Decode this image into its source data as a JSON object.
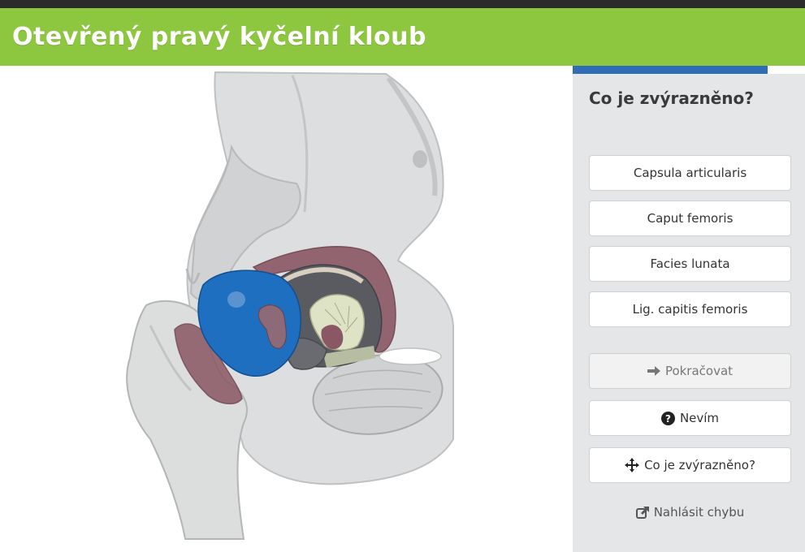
{
  "header": {
    "title": "Otevřený pravý kyčelní kloub"
  },
  "progress": {
    "fraction": 0.84,
    "color": "#2f6db5"
  },
  "quiz": {
    "question": "Co je zvýrazněno?",
    "options": [
      "Capsula articularis",
      "Caput femoris",
      "Facies lunata",
      "Lig. capitis femoris"
    ],
    "continue_label": "Pokračovat",
    "dont_know_label": "Nevím",
    "what_highlighted_label": "Co je zvýrazněno?",
    "report_label": "Nahlásit chybu"
  },
  "colors": {
    "header_bg": "#8dc63f",
    "highlight": "#1f6fc0",
    "bone": "#d6d7d8",
    "muscle": "#7d4a55"
  },
  "icons": {
    "continue": "arrow-right-icon",
    "dont_know": "question-circle-icon",
    "what_highlighted": "move-arrows-icon",
    "report": "external-link-icon"
  }
}
